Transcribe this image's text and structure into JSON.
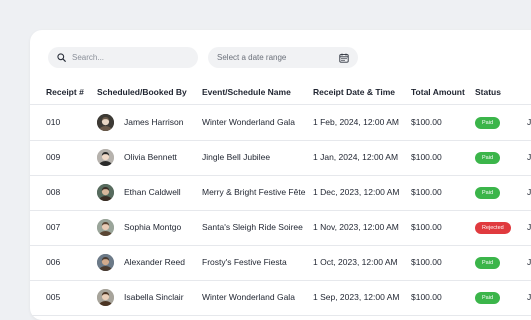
{
  "search": {
    "placeholder": "Search..."
  },
  "date_range": {
    "placeholder": "Select a date range"
  },
  "table": {
    "columns": [
      "Receipt #",
      "Scheduled/Booked By",
      "Event/Schedule Name",
      "Receipt Date & Time",
      "Total Amount",
      "Status"
    ],
    "rows": [
      {
        "receipt": "010",
        "name": "James Harrison",
        "event": "Winter Wonderland Gala",
        "datetime": "1 Feb, 2024, 12:00 AM",
        "amount": "$100.00",
        "status": "Paid",
        "status_color": "#3bb54a",
        "trunc": "J"
      },
      {
        "receipt": "009",
        "name": "Olivia Bennett",
        "event": "Jingle Bell Jubilee",
        "datetime": "1 Jan, 2024, 12:00 AM",
        "amount": "$100.00",
        "status": "Paid",
        "status_color": "#3bb54a",
        "trunc": "J"
      },
      {
        "receipt": "008",
        "name": "Ethan Caldwell",
        "event": "Merry & Bright Festive Fête",
        "datetime": "1 Dec, 2023, 12:00 AM",
        "amount": "$100.00",
        "status": "Paid",
        "status_color": "#3bb54a",
        "trunc": "J"
      },
      {
        "receipt": "007",
        "name": "Sophia Montgo",
        "event": "Santa's Sleigh Ride Soiree",
        "datetime": "1 Nov, 2023, 12:00 AM",
        "amount": "$100.00",
        "status": "Rejected",
        "status_color": "#e03a3e",
        "trunc": "J"
      },
      {
        "receipt": "006",
        "name": "Alexander Reed",
        "event": "Frosty's Festive Fiesta",
        "datetime": "1 Oct, 2023, 12:00 AM",
        "amount": "$100.00",
        "status": "Paid",
        "status_color": "#3bb54a",
        "trunc": "J"
      },
      {
        "receipt": "005",
        "name": "Isabella Sinclair",
        "event": "Winter Wonderland Gala",
        "datetime": "1 Sep, 2023, 12:00 AM",
        "amount": "$100.00",
        "status": "Paid",
        "status_color": "#3bb54a",
        "trunc": "J"
      }
    ]
  },
  "icons": {
    "search": "search-icon",
    "calendar": "calendar-icon"
  }
}
